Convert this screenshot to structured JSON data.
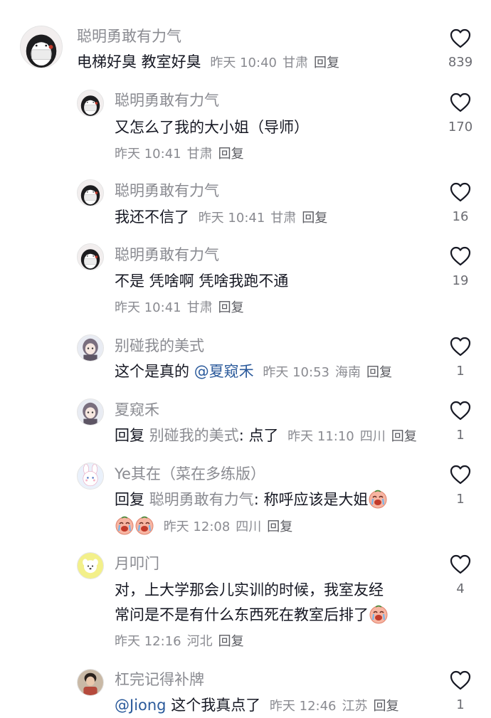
{
  "comments": [
    {
      "user": "聪明勇敢有力气",
      "avatar": "penguin-avatar",
      "text": "电梯好臭 教室好臭",
      "time": "昨天 10:40",
      "location": "甘肃",
      "reply_label": "回复",
      "likes": "839"
    },
    {
      "user": "聪明勇敢有力气",
      "avatar": "penguin-avatar",
      "text": "又怎么了我的大小姐（导师）",
      "time": "昨天 10:41",
      "location": "甘肃",
      "reply_label": "回复",
      "likes": "170"
    },
    {
      "user": "聪明勇敢有力气",
      "avatar": "penguin-avatar",
      "text": "我还不信了",
      "time": "昨天 10:41",
      "location": "甘肃",
      "reply_label": "回复",
      "likes": "16"
    },
    {
      "user": "聪明勇敢有力气",
      "avatar": "penguin-avatar",
      "text": "不是 凭啥啊 凭啥我跑不通",
      "time": "昨天 10:41",
      "location": "甘肃",
      "reply_label": "回复",
      "likes": "19"
    },
    {
      "user": "别碰我的美式",
      "avatar": "anime-avatar",
      "text": "这个是真的",
      "mention": "@夏窥禾",
      "time": "昨天 10:53",
      "location": "海南",
      "reply_label": "回复",
      "likes": "1"
    },
    {
      "user": "夏窥禾",
      "avatar": "anime-avatar",
      "reply_prefix": "回复",
      "reply_to": "别碰我的美式",
      "text": ": 点了",
      "time": "昨天 11:10",
      "location": "四川",
      "reply_label": "回复",
      "likes": "1"
    },
    {
      "user": "Ye其在（菜在多练版）",
      "avatar": "bunny-avatar",
      "reply_prefix": "回复",
      "reply_to": "聪明勇敢有力气",
      "text": ": 称呼应该是大姐",
      "emoji": "crying-emoji",
      "time": "昨天 12:08",
      "location": "四川",
      "reply_label": "回复",
      "likes": "1"
    },
    {
      "user": "月叩门",
      "avatar": "dog-avatar",
      "text_line1": "对，上大学那会儿实训的时候，我室友经",
      "text_line2": "常问是不是有什么东西死在教室后排了",
      "emoji": "crying-emoji",
      "time": "昨天 12:16",
      "location": "河北",
      "reply_label": "回复",
      "likes": "4"
    },
    {
      "user": "杠完记得补牌",
      "avatar": "person-avatar",
      "mention": "@Jiong",
      "text": " 这个我真点了",
      "time": "昨天 12:46",
      "location": "江苏",
      "reply_label": "回复",
      "likes": "1"
    }
  ],
  "colors": {
    "username": "#8a8b91",
    "text": "#161823",
    "mention": "#2b5a9b",
    "like_outline": "#161823"
  }
}
